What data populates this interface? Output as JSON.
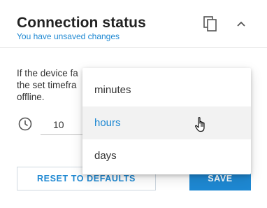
{
  "header": {
    "title": "Connection status",
    "subtitle": "You have unsaved changes"
  },
  "description": {
    "line1": "If the device fa",
    "line2": "the set timefra",
    "line3": "offline."
  },
  "timeout": {
    "value": "10",
    "selected_unit": "hours"
  },
  "dropdown": {
    "options": [
      "minutes",
      "hours",
      "days"
    ],
    "highlighted": "hours"
  },
  "buttons": {
    "reset_label": "RESET TO DEFAULTS",
    "save_label": "SAVE"
  },
  "colors": {
    "accent": "#1e88d2",
    "hover_bg": "#f2f2f2"
  },
  "icons": [
    "copy-icon",
    "chevron-up-icon",
    "clock-icon",
    "hand-pointer-cursor"
  ]
}
